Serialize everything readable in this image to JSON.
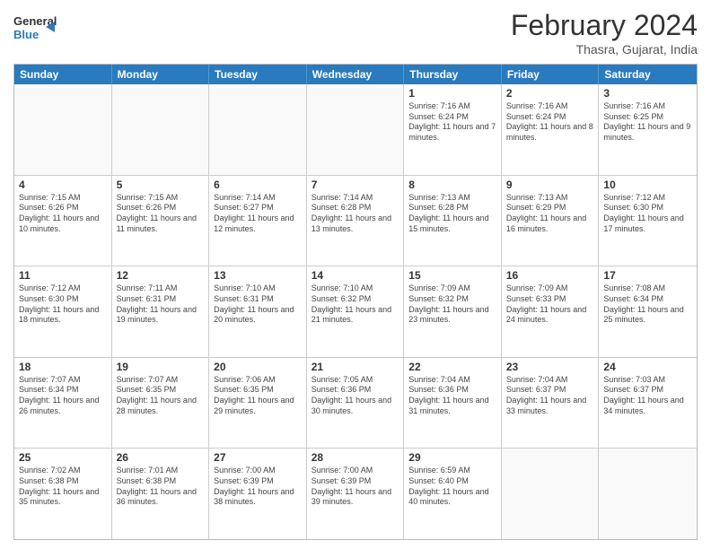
{
  "header": {
    "logo_general": "General",
    "logo_blue": "Blue",
    "title": "February 2024",
    "subtitle": "Thasra, Gujarat, India"
  },
  "days_of_week": [
    "Sunday",
    "Monday",
    "Tuesday",
    "Wednesday",
    "Thursday",
    "Friday",
    "Saturday"
  ],
  "weeks": [
    [
      {
        "day": "",
        "info": ""
      },
      {
        "day": "",
        "info": ""
      },
      {
        "day": "",
        "info": ""
      },
      {
        "day": "",
        "info": ""
      },
      {
        "day": "1",
        "info": "Sunrise: 7:16 AM\nSunset: 6:24 PM\nDaylight: 11 hours and 7 minutes."
      },
      {
        "day": "2",
        "info": "Sunrise: 7:16 AM\nSunset: 6:24 PM\nDaylight: 11 hours and 8 minutes."
      },
      {
        "day": "3",
        "info": "Sunrise: 7:16 AM\nSunset: 6:25 PM\nDaylight: 11 hours and 9 minutes."
      }
    ],
    [
      {
        "day": "4",
        "info": "Sunrise: 7:15 AM\nSunset: 6:26 PM\nDaylight: 11 hours and 10 minutes."
      },
      {
        "day": "5",
        "info": "Sunrise: 7:15 AM\nSunset: 6:26 PM\nDaylight: 11 hours and 11 minutes."
      },
      {
        "day": "6",
        "info": "Sunrise: 7:14 AM\nSunset: 6:27 PM\nDaylight: 11 hours and 12 minutes."
      },
      {
        "day": "7",
        "info": "Sunrise: 7:14 AM\nSunset: 6:28 PM\nDaylight: 11 hours and 13 minutes."
      },
      {
        "day": "8",
        "info": "Sunrise: 7:13 AM\nSunset: 6:28 PM\nDaylight: 11 hours and 15 minutes."
      },
      {
        "day": "9",
        "info": "Sunrise: 7:13 AM\nSunset: 6:29 PM\nDaylight: 11 hours and 16 minutes."
      },
      {
        "day": "10",
        "info": "Sunrise: 7:12 AM\nSunset: 6:30 PM\nDaylight: 11 hours and 17 minutes."
      }
    ],
    [
      {
        "day": "11",
        "info": "Sunrise: 7:12 AM\nSunset: 6:30 PM\nDaylight: 11 hours and 18 minutes."
      },
      {
        "day": "12",
        "info": "Sunrise: 7:11 AM\nSunset: 6:31 PM\nDaylight: 11 hours and 19 minutes."
      },
      {
        "day": "13",
        "info": "Sunrise: 7:10 AM\nSunset: 6:31 PM\nDaylight: 11 hours and 20 minutes."
      },
      {
        "day": "14",
        "info": "Sunrise: 7:10 AM\nSunset: 6:32 PM\nDaylight: 11 hours and 21 minutes."
      },
      {
        "day": "15",
        "info": "Sunrise: 7:09 AM\nSunset: 6:32 PM\nDaylight: 11 hours and 23 minutes."
      },
      {
        "day": "16",
        "info": "Sunrise: 7:09 AM\nSunset: 6:33 PM\nDaylight: 11 hours and 24 minutes."
      },
      {
        "day": "17",
        "info": "Sunrise: 7:08 AM\nSunset: 6:34 PM\nDaylight: 11 hours and 25 minutes."
      }
    ],
    [
      {
        "day": "18",
        "info": "Sunrise: 7:07 AM\nSunset: 6:34 PM\nDaylight: 11 hours and 26 minutes."
      },
      {
        "day": "19",
        "info": "Sunrise: 7:07 AM\nSunset: 6:35 PM\nDaylight: 11 hours and 28 minutes."
      },
      {
        "day": "20",
        "info": "Sunrise: 7:06 AM\nSunset: 6:35 PM\nDaylight: 11 hours and 29 minutes."
      },
      {
        "day": "21",
        "info": "Sunrise: 7:05 AM\nSunset: 6:36 PM\nDaylight: 11 hours and 30 minutes."
      },
      {
        "day": "22",
        "info": "Sunrise: 7:04 AM\nSunset: 6:36 PM\nDaylight: 11 hours and 31 minutes."
      },
      {
        "day": "23",
        "info": "Sunrise: 7:04 AM\nSunset: 6:37 PM\nDaylight: 11 hours and 33 minutes."
      },
      {
        "day": "24",
        "info": "Sunrise: 7:03 AM\nSunset: 6:37 PM\nDaylight: 11 hours and 34 minutes."
      }
    ],
    [
      {
        "day": "25",
        "info": "Sunrise: 7:02 AM\nSunset: 6:38 PM\nDaylight: 11 hours and 35 minutes."
      },
      {
        "day": "26",
        "info": "Sunrise: 7:01 AM\nSunset: 6:38 PM\nDaylight: 11 hours and 36 minutes."
      },
      {
        "day": "27",
        "info": "Sunrise: 7:00 AM\nSunset: 6:39 PM\nDaylight: 11 hours and 38 minutes."
      },
      {
        "day": "28",
        "info": "Sunrise: 7:00 AM\nSunset: 6:39 PM\nDaylight: 11 hours and 39 minutes."
      },
      {
        "day": "29",
        "info": "Sunrise: 6:59 AM\nSunset: 6:40 PM\nDaylight: 11 hours and 40 minutes."
      },
      {
        "day": "",
        "info": ""
      },
      {
        "day": "",
        "info": ""
      }
    ]
  ]
}
